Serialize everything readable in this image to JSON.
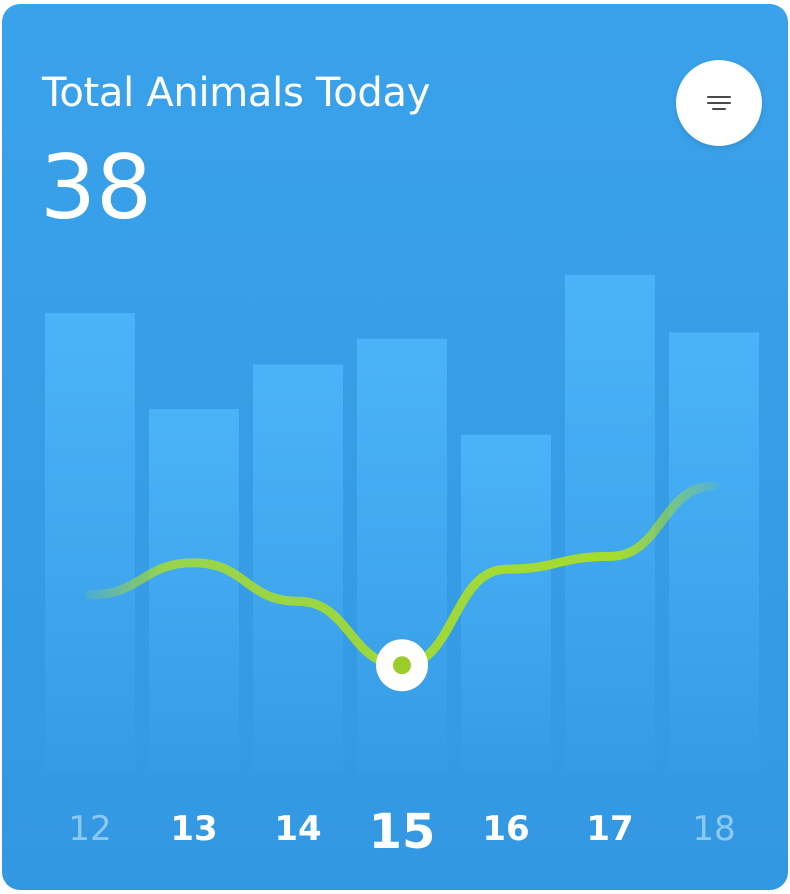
{
  "card": {
    "title": "Total Animals Today",
    "value": "38",
    "menu_icon": "filter-lines-icon"
  },
  "colors": {
    "card_bg": "#3aa2ea",
    "bar": "#4cb4f8",
    "line": "#a6dc2e",
    "marker_fill": "#ffffff",
    "marker_dot": "#9ccc2a",
    "tick_active": "#ffffff",
    "tick_faded": "#8cc8f0"
  },
  "chart_data": {
    "type": "bar",
    "categories": [
      "12",
      "13",
      "14",
      "15",
      "16",
      "17",
      "18"
    ],
    "series": [
      {
        "values": [
          0.72,
          0.57,
          0.64,
          0.68,
          0.53,
          0.78,
          0.69
        ]
      },
      {
        "type": "line",
        "values": [
          0.28,
          0.33,
          0.27,
          0.17,
          0.32,
          0.34,
          0.45
        ]
      }
    ],
    "selected_category": "15",
    "faded_categories": [
      "12",
      "18"
    ],
    "ylim": [
      0,
      1
    ],
    "grid": false
  }
}
